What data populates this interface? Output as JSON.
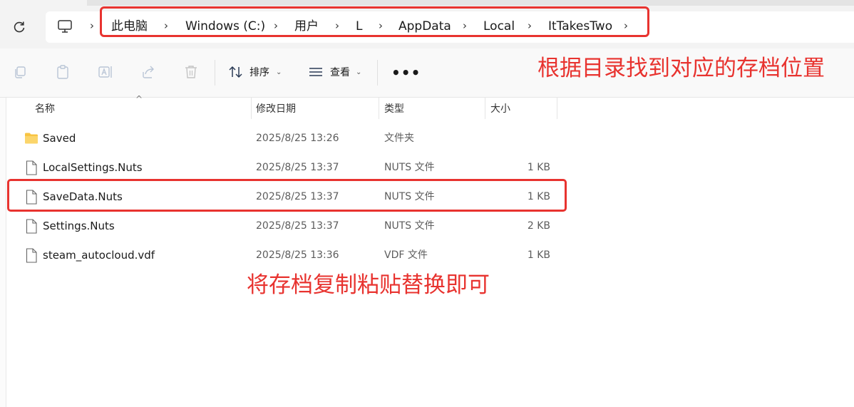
{
  "breadcrumb": {
    "items": [
      "此电脑",
      "Windows (C:)",
      "用户",
      "L",
      "AppData",
      "Local",
      "ItTakesTwo"
    ]
  },
  "toolbar": {
    "sort_label": "排序",
    "view_label": "查看",
    "more_label": "•••"
  },
  "columns": {
    "name": "名称",
    "date": "修改日期",
    "type": "类型",
    "size": "大小"
  },
  "files": [
    {
      "name": "Saved",
      "date": "2025/8/25 13:26",
      "type": "文件夹",
      "size": "",
      "icon": "folder-icon"
    },
    {
      "name": "LocalSettings.Nuts",
      "date": "2025/8/25 13:37",
      "type": "NUTS 文件",
      "size": "1 KB",
      "icon": "file-icon"
    },
    {
      "name": "SaveData.Nuts",
      "date": "2025/8/25 13:37",
      "type": "NUTS 文件",
      "size": "1 KB",
      "icon": "file-icon"
    },
    {
      "name": "Settings.Nuts",
      "date": "2025/8/25 13:37",
      "type": "NUTS 文件",
      "size": "2 KB",
      "icon": "file-icon"
    },
    {
      "name": "steam_autocloud.vdf",
      "date": "2025/8/25 13:36",
      "type": "VDF 文件",
      "size": "1 KB",
      "icon": "file-icon"
    }
  ],
  "annotations": {
    "top": "根据目录找到对应的存档位置",
    "bottom": "将存档复制粘贴替换即可"
  },
  "colors": {
    "annotation": "#e8332f",
    "folder": "#f8c443"
  }
}
